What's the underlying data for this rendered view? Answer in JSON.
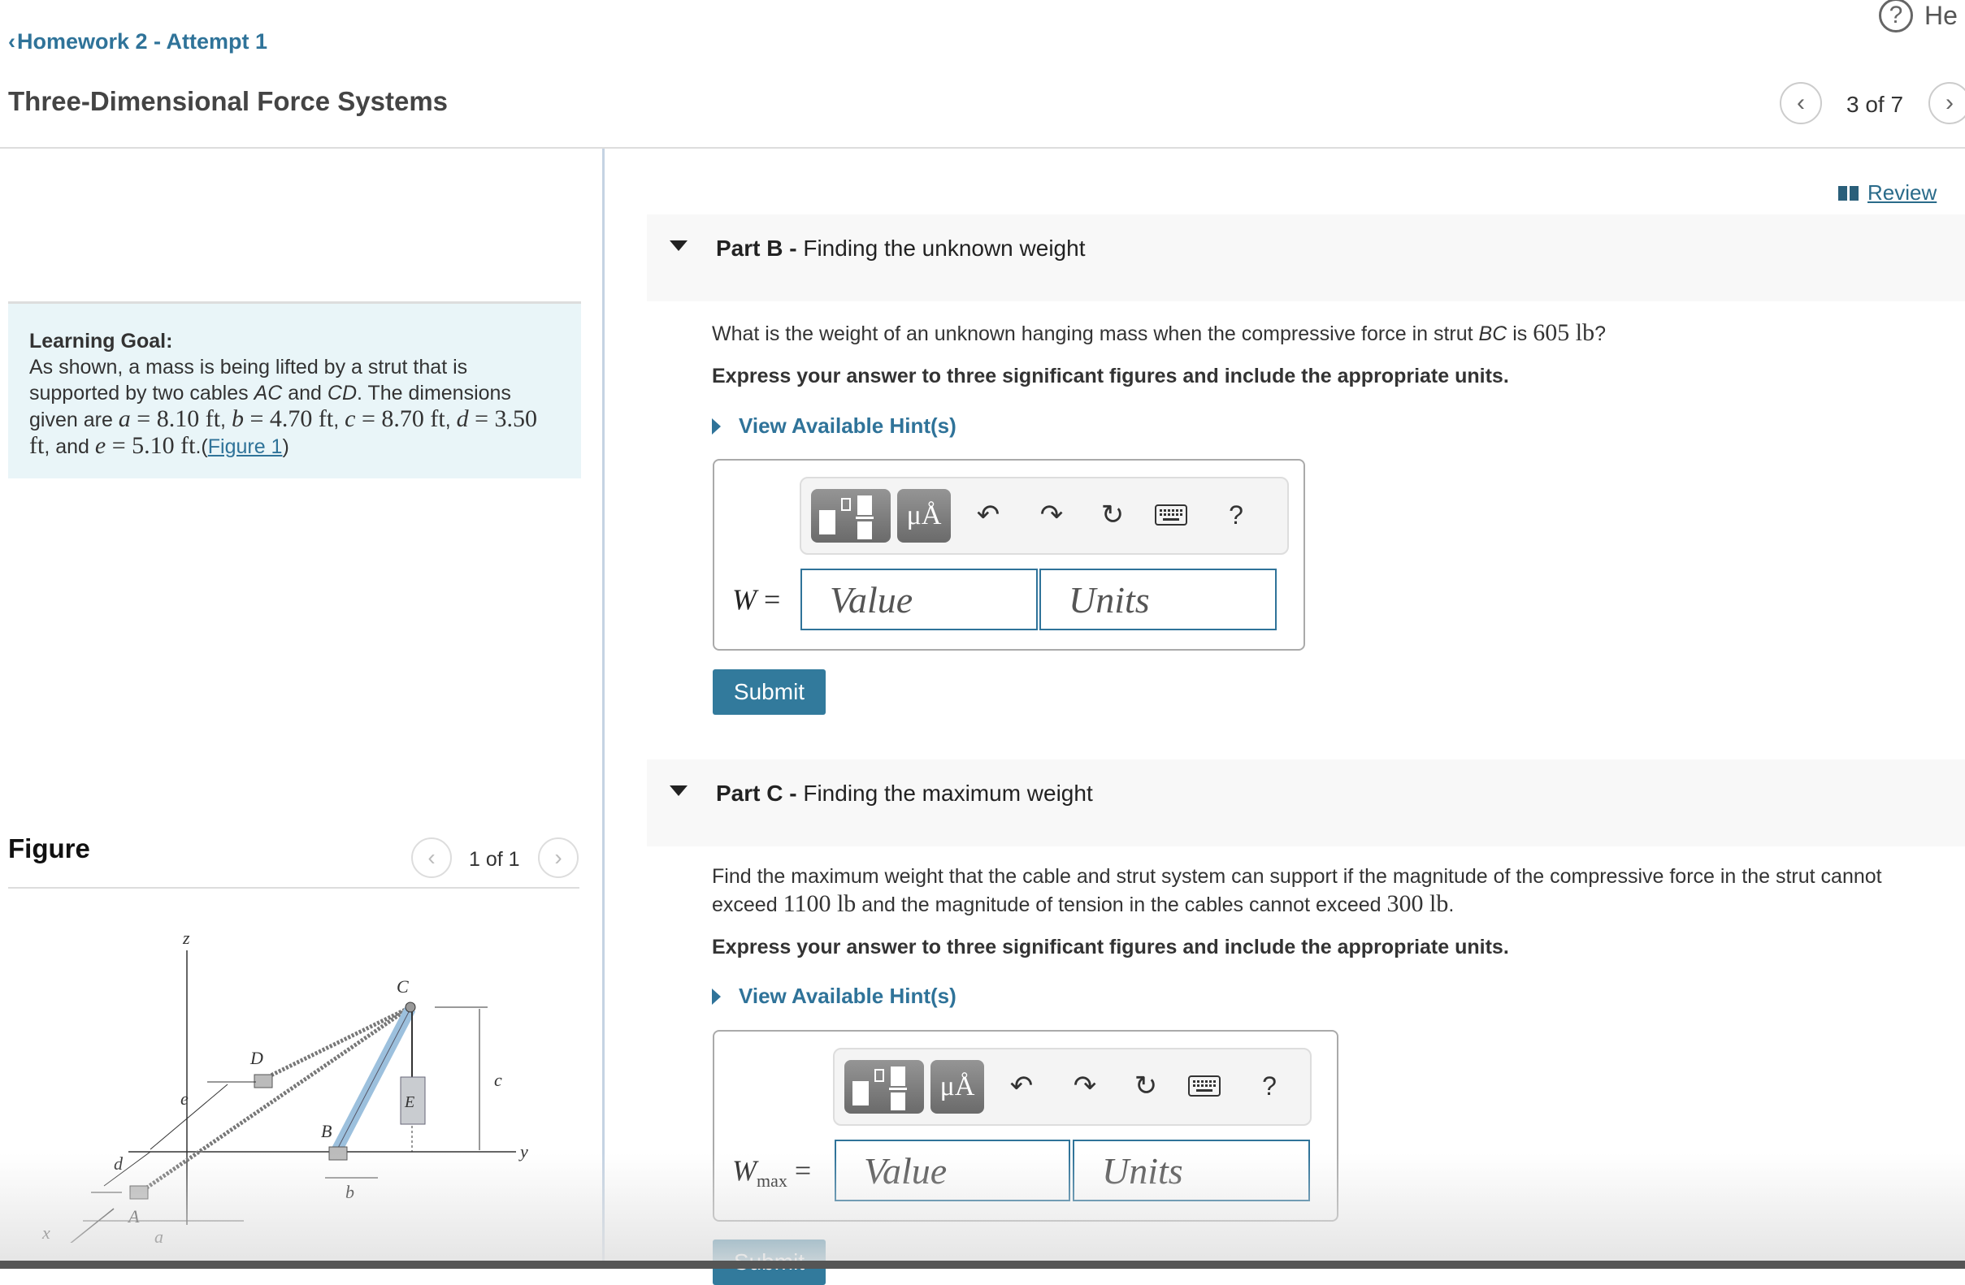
{
  "header": {
    "back_label": "Homework 2 - Attempt 1",
    "title": "Three-Dimensional Force Systems",
    "help_label": "He",
    "pager": "3 of 7"
  },
  "left": {
    "goal_heading": "Learning Goal:",
    "goal_text_1": "As shown, a mass is being lifted by a strut that is supported by two cables ",
    "cable1": "AC",
    "and": " and ",
    "cable2": "CD",
    "goal_text_2": ". The dimensions given are ",
    "dims": [
      {
        "var": "a",
        "value": "8.10",
        "unit": "ft"
      },
      {
        "var": "b",
        "value": "4.70",
        "unit": "ft"
      },
      {
        "var": "c",
        "value": "8.70",
        "unit": "ft"
      },
      {
        "var": "d",
        "value": "3.50",
        "unit": "ft"
      },
      {
        "var": "e",
        "value": "5.10",
        "unit": "ft"
      }
    ],
    "figure_link": "Figure 1",
    "figure_title": "Figure",
    "figure_pager": "1 of 1",
    "figure_labels": {
      "z": "z",
      "y": "y",
      "x": "x",
      "A": "A",
      "B": "B",
      "C": "C",
      "D": "D",
      "E": "E",
      "a": "a",
      "b": "b",
      "c": "c",
      "d": "d",
      "e": "e"
    }
  },
  "review_label": "Review",
  "partB": {
    "part": "Part B -",
    "title": "Finding the unknown weight",
    "question_pre": "What is the weight of an unknown hanging mass when the compressive force in strut ",
    "strut": "BC",
    "question_mid": " is ",
    "force": "605 lb",
    "question_post": "?",
    "instruction": "Express your answer to three significant figures and include the appropriate units.",
    "hint": "View Available Hint(s)",
    "label_var": "W",
    "label_sub": "",
    "value_placeholder": "Value",
    "units_placeholder": "Units",
    "submit": "Submit"
  },
  "partC": {
    "part": "Part C -",
    "title": "Finding the maximum weight",
    "question_1": "Find the maximum weight that the cable and strut system can support if the magnitude of the compressive force in the strut cannot exceed ",
    "compress_max": "1100 lb",
    "question_2": " and the magnitude of tension in the cables cannot exceed ",
    "tension_max": "300 lb",
    "question_3": ".",
    "instruction": "Express your answer to three significant figures and include the appropriate units.",
    "hint": "View Available Hint(s)",
    "label_var": "W",
    "label_sub": "max",
    "value_placeholder": "Value",
    "units_placeholder": "Units",
    "submit": "Submit"
  },
  "toolbar": {
    "templates_icon": "fraction-template-icon",
    "units_button": "μÅ",
    "undo_icon": "undo-icon",
    "redo_icon": "redo-icon",
    "reset_icon": "reset-icon",
    "keyboard_icon": "keyboard-icon",
    "help": "?"
  }
}
